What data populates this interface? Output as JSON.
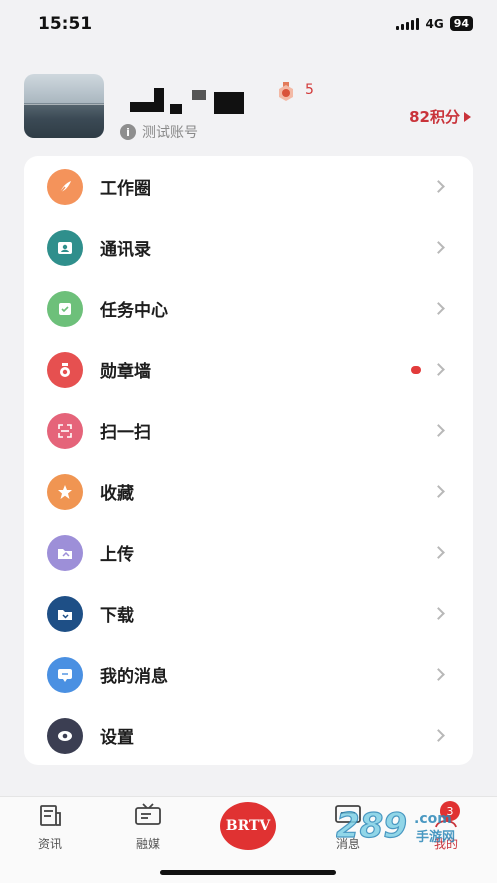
{
  "status_bar": {
    "time": "15:51",
    "network": "4G",
    "battery": "94"
  },
  "profile": {
    "medal_count": "5",
    "account_label": "测试账号",
    "points": "82积分"
  },
  "menu": {
    "items": [
      {
        "label": "工作圈",
        "icon": "feather-icon",
        "color": "#f4935b"
      },
      {
        "label": "通讯录",
        "icon": "contacts-icon",
        "color": "#2f8f8c"
      },
      {
        "label": "任务中心",
        "icon": "task-icon",
        "color": "#6dc07a"
      },
      {
        "label": "勋章墙",
        "icon": "medal-icon",
        "color": "#e65050",
        "badge": true
      },
      {
        "label": "扫一扫",
        "icon": "scan-icon",
        "color": "#e5647a"
      },
      {
        "label": "收藏",
        "icon": "star-icon",
        "color": "#f09552"
      },
      {
        "label": "上传",
        "icon": "upload-icon",
        "color": "#9d8fd8"
      },
      {
        "label": "下载",
        "icon": "download-icon",
        "color": "#1e4f86"
      },
      {
        "label": "我的消息",
        "icon": "message-icon",
        "color": "#4a90e2"
      },
      {
        "label": "设置",
        "icon": "settings-icon",
        "color": "#3b3e52"
      }
    ]
  },
  "tabbar": {
    "news": "资讯",
    "media": "融媒",
    "brtv": "BRTV",
    "messages": "消息",
    "mine": "我的",
    "messages_badge": "3"
  },
  "watermark": {
    "text": "289",
    "suffix": "手游网",
    "domain": ".com"
  }
}
